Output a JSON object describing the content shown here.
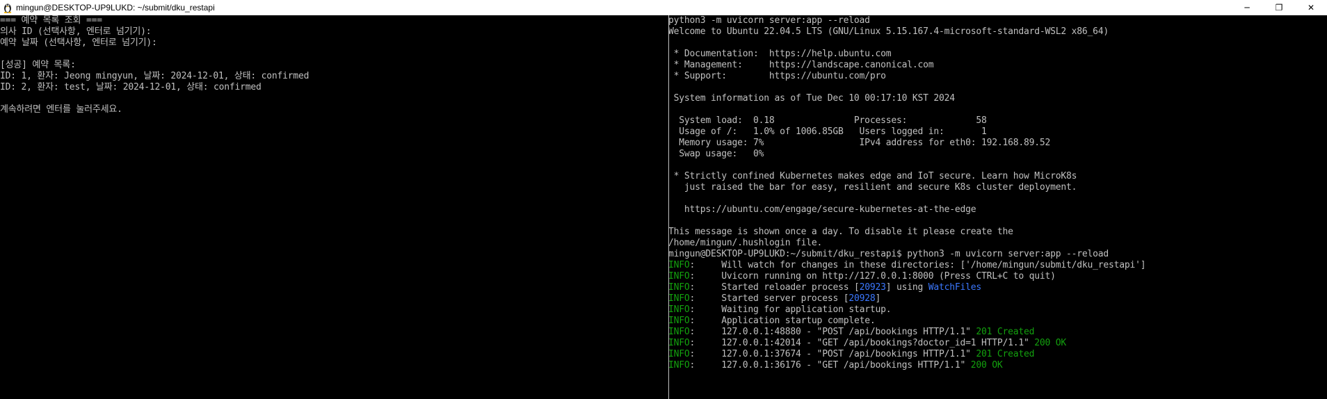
{
  "window": {
    "title": "mingun@DESKTOP-UP9LUKD: ~/submit/dku_restapi",
    "minimize": "─",
    "restore": "❐",
    "close": "✕"
  },
  "colors": {
    "terminal_bg": "#000000",
    "text": "#c0c0c0",
    "green": "#13a10e",
    "blue": "#3b78ff"
  },
  "left_pane": {
    "lines": [
      "=== 예약 목록 조회 ===",
      "의사 ID (선택사항, 엔터로 넘기기):",
      "예약 날짜 (선택사항, 엔터로 넘기기):",
      "",
      "[성공] 예약 목록:",
      "ID: 1, 환자: Jeong mingyun, 날짜: 2024-12-01, 상태: confirmed",
      "ID: 2, 환자: test, 날짜: 2024-12-01, 상태: confirmed",
      "",
      "계속하려면 엔터를 눌러주세요."
    ]
  },
  "right_pane": {
    "header_lines": [
      "python3 -m uvicorn server:app --reload",
      "Welcome to Ubuntu 22.04.5 LTS (GNU/Linux 5.15.167.4-microsoft-standard-WSL2 x86_64)",
      "",
      " * Documentation:  https://help.ubuntu.com",
      " * Management:     https://landscape.canonical.com",
      " * Support:        https://ubuntu.com/pro",
      "",
      " System information as of Tue Dec 10 00:17:10 KST 2024",
      "",
      "  System load:  0.18               Processes:             58",
      "  Usage of /:   1.0% of 1006.85GB   Users logged in:       1",
      "  Memory usage: 7%                  IPv4 address for eth0: 192.168.89.52",
      "  Swap usage:   0%",
      "",
      " * Strictly confined Kubernetes makes edge and IoT secure. Learn how MicroK8s",
      "   just raised the bar for easy, resilient and secure K8s cluster deployment.",
      "",
      "   https://ubuntu.com/engage/secure-kubernetes-at-the-edge",
      "",
      "This message is shown once a day. To disable it please create the",
      "/home/mingun/.hushlogin file.",
      "mingun@DESKTOP-UP9LUKD:~/submit/dku_restapi$ python3 -m uvicorn server:app --reload"
    ],
    "log_level": "INFO",
    "log_sep": ":     ",
    "logs": {
      "l1": "Will watch for changes in these directories: ['/home/mingun/submit/dku_restapi']",
      "l2": "Uvicorn running on http://127.0.0.1:8000 (Press CTRL+C to quit)",
      "l3_pre": "Started reloader process [",
      "l3_pid": "20923",
      "l3_mid": "] using ",
      "l3_tool": "WatchFiles",
      "l4_pre": "Started server process [",
      "l4_pid": "20928",
      "l4_post": "]",
      "l5": "Waiting for application startup.",
      "l6": "Application startup complete.",
      "l7": "127.0.0.1:48880 - \"POST /api/bookings HTTP/1.1\" ",
      "l7_status": "201 Created",
      "l8": "127.0.0.1:42014 - \"GET /api/bookings?doctor_id=1 HTTP/1.1\" ",
      "l8_status": "200 OK",
      "l9": "127.0.0.1:37674 - \"POST /api/bookings HTTP/1.1\" ",
      "l9_status": "201 Created",
      "l10": "127.0.0.1:36176 - \"GET /api/bookings HTTP/1.1\" ",
      "l10_status": "200 OK"
    }
  }
}
